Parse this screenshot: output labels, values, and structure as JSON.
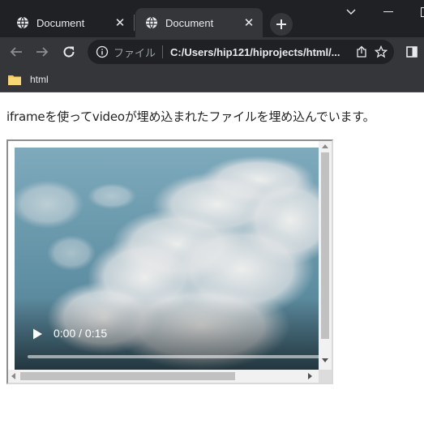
{
  "browser": {
    "tabs": [
      {
        "title": "Document",
        "active": false
      },
      {
        "title": "Document",
        "active": true
      }
    ],
    "address_bar": {
      "scheme_label": "ファイル",
      "url": "C:/Users/hip121/hiprojects/html/..."
    },
    "bookmarks": [
      {
        "label": "html"
      }
    ]
  },
  "page": {
    "paragraph": "iframeを使ってvideoが埋め込まれたファイルを埋め込んでいます。",
    "video": {
      "time_display": "0:00 / 0:15",
      "progress": 0
    }
  },
  "colors": {
    "tabstrip_bg": "#202124",
    "toolbar_bg": "#35363a",
    "folder": "#f2c94c"
  },
  "icons": [
    "globe-icon",
    "close-icon",
    "plus-icon",
    "minimize-icon",
    "chevron-down-icon",
    "back-icon",
    "forward-icon",
    "reload-icon",
    "info-icon",
    "share-icon",
    "star-icon",
    "side-panel-icon",
    "folder-icon",
    "play-icon"
  ]
}
